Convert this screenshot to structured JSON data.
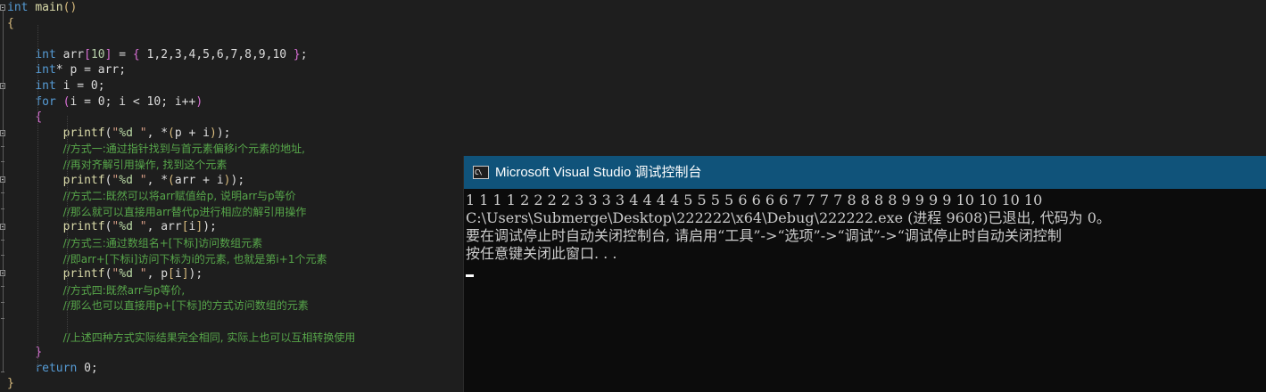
{
  "editor": {
    "lines": [
      {
        "parts": [
          {
            "c": "kw",
            "t": "int"
          },
          {
            "c": "id",
            "t": " "
          },
          {
            "c": "fn",
            "t": "main"
          },
          {
            "c": "br",
            "t": "()"
          }
        ]
      },
      {
        "parts": [
          {
            "c": "br",
            "t": "{"
          }
        ]
      },
      {
        "parts": []
      },
      {
        "parts": [
          {
            "c": "id",
            "t": "    "
          },
          {
            "c": "kw",
            "t": "int"
          },
          {
            "c": "id",
            "t": " arr"
          },
          {
            "c": "brpink",
            "t": "["
          },
          {
            "c": "num",
            "t": "10"
          },
          {
            "c": "brpink",
            "t": "]"
          },
          {
            "c": "id",
            "t": " = "
          },
          {
            "c": "brpink",
            "t": "{"
          },
          {
            "c": "id",
            "t": " 1,2,3,4,5,6,7,8,9,10 "
          },
          {
            "c": "brpink",
            "t": "}"
          },
          {
            "c": "id",
            "t": ";"
          }
        ]
      },
      {
        "parts": [
          {
            "c": "id",
            "t": "    "
          },
          {
            "c": "kw",
            "t": "int"
          },
          {
            "c": "id",
            "t": "* p = arr;"
          }
        ]
      },
      {
        "parts": [
          {
            "c": "id",
            "t": "    "
          },
          {
            "c": "kw",
            "t": "int"
          },
          {
            "c": "id",
            "t": " i = 0;"
          }
        ]
      },
      {
        "parts": [
          {
            "c": "id",
            "t": "    "
          },
          {
            "c": "kw",
            "t": "for"
          },
          {
            "c": "id",
            "t": " "
          },
          {
            "c": "brpink",
            "t": "("
          },
          {
            "c": "id",
            "t": "i = 0; i < 10; i++"
          },
          {
            "c": "brpink",
            "t": ")"
          }
        ]
      },
      {
        "parts": [
          {
            "c": "id",
            "t": "    "
          },
          {
            "c": "brpink",
            "t": "{"
          }
        ]
      },
      {
        "parts": [
          {
            "c": "id",
            "t": "        "
          },
          {
            "c": "fn",
            "t": "printf"
          },
          {
            "c": "id",
            "t": "("
          },
          {
            "c": "str",
            "t": "\""
          },
          {
            "c": "fmt",
            "t": "%d"
          },
          {
            "c": "str",
            "t": " \""
          },
          {
            "c": "id",
            "t": ", *"
          },
          {
            "c": "br",
            "t": "("
          },
          {
            "c": "id",
            "t": "p + i"
          },
          {
            "c": "br",
            "t": ")"
          },
          {
            "c": "id",
            "t": ");"
          }
        ]
      },
      {
        "parts": [
          {
            "c": "id",
            "t": "        "
          },
          {
            "c": "cm",
            "t": "//方式一:通过指针找到与首元素偏移i个元素的地址,"
          }
        ]
      },
      {
        "parts": [
          {
            "c": "id",
            "t": "        "
          },
          {
            "c": "cm",
            "t": "//再对齐解引用操作, 找到这个元素"
          }
        ]
      },
      {
        "parts": [
          {
            "c": "id",
            "t": "        "
          },
          {
            "c": "fn",
            "t": "printf"
          },
          {
            "c": "id",
            "t": "("
          },
          {
            "c": "str",
            "t": "\""
          },
          {
            "c": "fmt",
            "t": "%d"
          },
          {
            "c": "str",
            "t": " \""
          },
          {
            "c": "id",
            "t": ", *"
          },
          {
            "c": "br",
            "t": "("
          },
          {
            "c": "id",
            "t": "arr + i"
          },
          {
            "c": "br",
            "t": ")"
          },
          {
            "c": "id",
            "t": ");"
          }
        ]
      },
      {
        "parts": [
          {
            "c": "id",
            "t": "        "
          },
          {
            "c": "cm",
            "t": "//方式二:既然可以将arr赋值给p, 说明arr与p等价"
          }
        ]
      },
      {
        "parts": [
          {
            "c": "id",
            "t": "        "
          },
          {
            "c": "cm",
            "t": "//那么就可以直接用arr替代p进行相应的解引用操作"
          }
        ]
      },
      {
        "parts": [
          {
            "c": "id",
            "t": "        "
          },
          {
            "c": "fn",
            "t": "printf"
          },
          {
            "c": "id",
            "t": "("
          },
          {
            "c": "str",
            "t": "\""
          },
          {
            "c": "fmt",
            "t": "%d"
          },
          {
            "c": "str",
            "t": " \""
          },
          {
            "c": "id",
            "t": ", arr"
          },
          {
            "c": "br",
            "t": "["
          },
          {
            "c": "id",
            "t": "i"
          },
          {
            "c": "br",
            "t": "]"
          },
          {
            "c": "id",
            "t": ");"
          }
        ]
      },
      {
        "parts": [
          {
            "c": "id",
            "t": "        "
          },
          {
            "c": "cm",
            "t": "//方式三:通过数组名+[下标]访问数组元素"
          }
        ]
      },
      {
        "parts": [
          {
            "c": "id",
            "t": "        "
          },
          {
            "c": "cm",
            "t": "//即arr+[下标i]访问下标为i的元素, 也就是第i+1个元素"
          }
        ]
      },
      {
        "parts": [
          {
            "c": "id",
            "t": "        "
          },
          {
            "c": "fn",
            "t": "printf"
          },
          {
            "c": "id",
            "t": "("
          },
          {
            "c": "str",
            "t": "\""
          },
          {
            "c": "fmt",
            "t": "%d"
          },
          {
            "c": "str",
            "t": " \""
          },
          {
            "c": "id",
            "t": ", p"
          },
          {
            "c": "br",
            "t": "["
          },
          {
            "c": "id",
            "t": "i"
          },
          {
            "c": "br",
            "t": "]"
          },
          {
            "c": "id",
            "t": ");"
          }
        ]
      },
      {
        "parts": [
          {
            "c": "id",
            "t": "        "
          },
          {
            "c": "cm",
            "t": "//方式四:既然arr与p等价,"
          }
        ]
      },
      {
        "parts": [
          {
            "c": "id",
            "t": "        "
          },
          {
            "c": "cm",
            "t": "//那么也可以直接用p+[下标]的方式访问数组的元素"
          }
        ]
      },
      {
        "parts": []
      },
      {
        "parts": [
          {
            "c": "id",
            "t": "        "
          },
          {
            "c": "cm",
            "t": "//上述四种方式实际结果完全相同, 实际上也可以互相转换使用"
          }
        ]
      },
      {
        "parts": [
          {
            "c": "id",
            "t": "    "
          },
          {
            "c": "brpink",
            "t": "}"
          }
        ]
      },
      {
        "parts": [
          {
            "c": "id",
            "t": "    "
          },
          {
            "c": "kw",
            "t": "return"
          },
          {
            "c": "id",
            "t": " 0;"
          }
        ]
      },
      {
        "parts": [
          {
            "c": "br",
            "t": "}"
          }
        ]
      }
    ]
  },
  "console": {
    "title": "Microsoft Visual Studio 调试控制台",
    "icon_label": "C\\",
    "output_lines": [
      "1 1 1 1 2 2 2 2 3 3 3 3 4 4 4 4 5 5 5 5 6 6 6 6 7 7 7 7 8 8 8 8 9 9 9 9 10 10 10 10",
      "C:\\Users\\Submerge\\Desktop\\222222\\x64\\Debug\\222222.exe (进程 9608)已退出, 代码为 0。",
      "要在调试停止时自动关闭控制台, 请启用“工具”->“选项”->“调试”->“调试停止时自动关闭控制",
      "按任意键关闭此窗口. . ."
    ]
  },
  "colors": {
    "editor_bg": "#1e1e1e",
    "keyword": "#569cd6",
    "function": "#dcdcaa",
    "comment": "#57a64a",
    "console_title_bg": "#10537a",
    "console_bg": "#0c0c0c"
  }
}
